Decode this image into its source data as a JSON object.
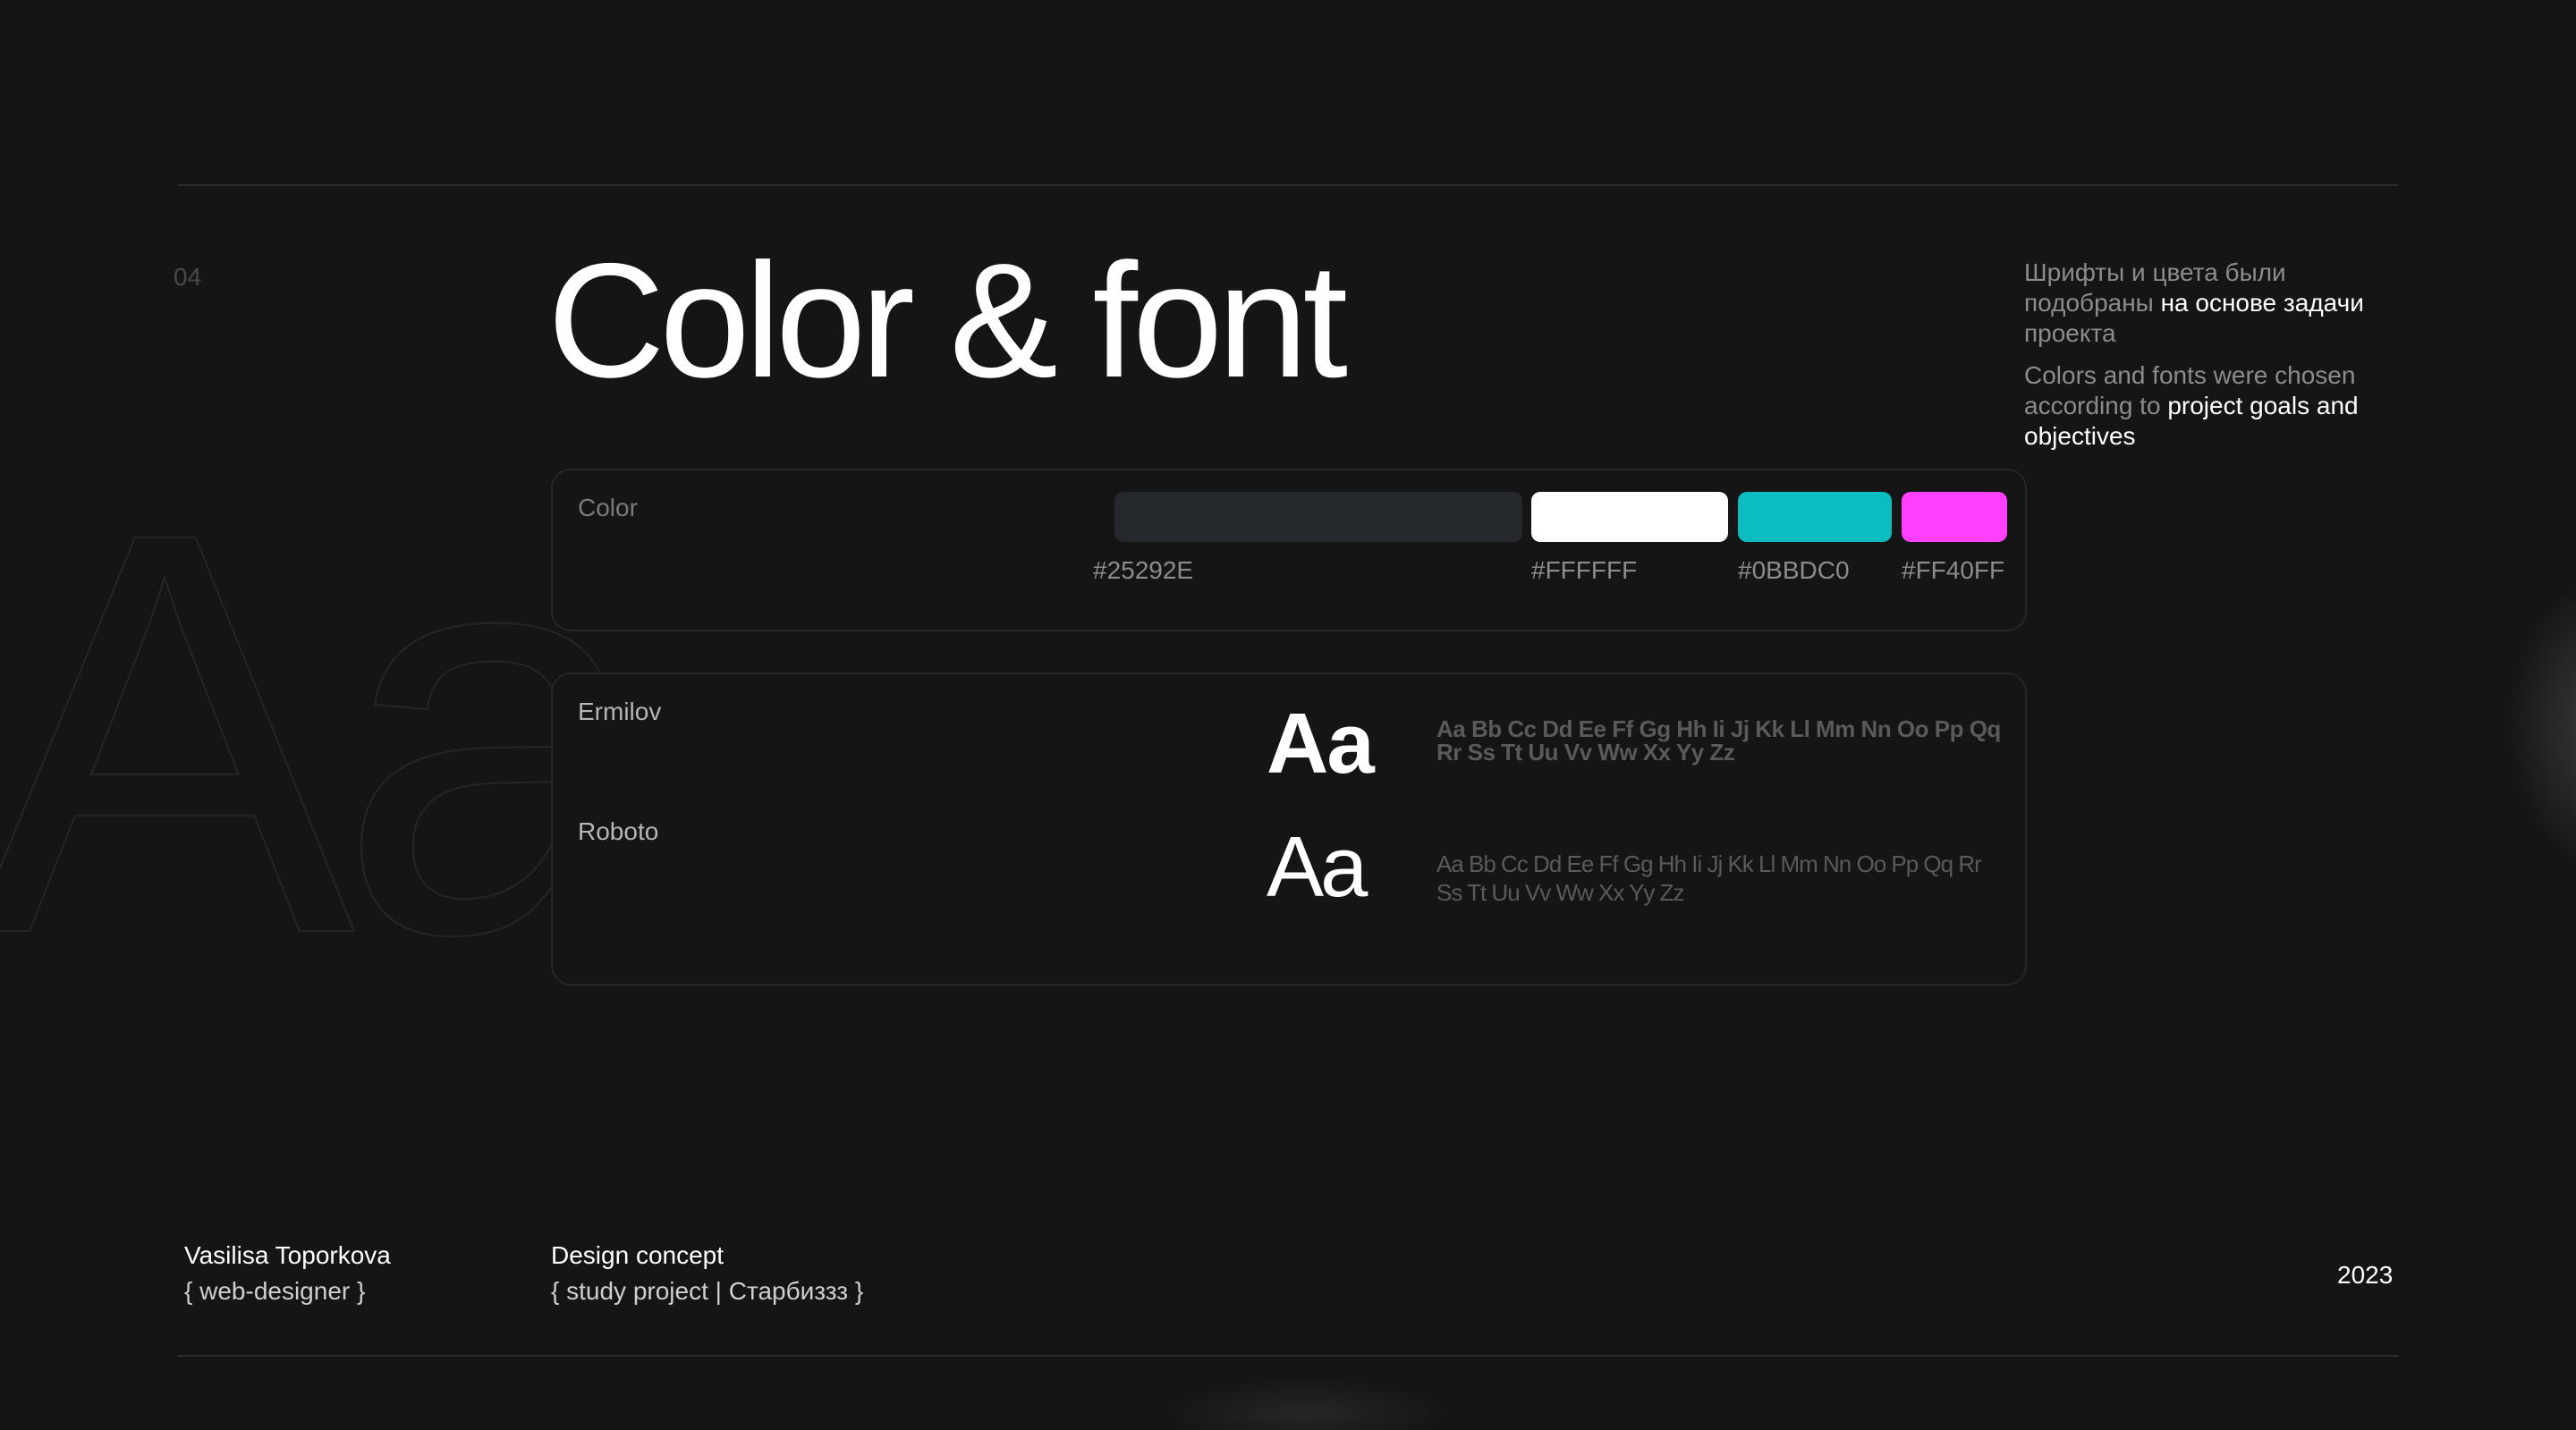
{
  "slide": {
    "number": "04",
    "title": "Color & font",
    "background_glyph": "Aa"
  },
  "description": {
    "ru_plain": "Шрифты и цвета были подобраны ",
    "ru_highlight": "на основе задачи",
    "ru_tail": " проекта",
    "en_plain": "Colors and fonts were chosen according to ",
    "en_highlight": "project goals and objectives"
  },
  "color_card": {
    "label": "Color",
    "swatches": [
      {
        "hex": "#25292E",
        "label": "#25292E"
      },
      {
        "hex": "#FFFFFF",
        "label": "#FFFFFF"
      },
      {
        "hex": "#0BBDC0",
        "label": "#0BBDC0"
      },
      {
        "hex": "#FF40FF",
        "label": "#FF40FF"
      }
    ]
  },
  "font_card": {
    "fonts": [
      {
        "name": "Ermilov",
        "sample": "Aa",
        "alphabet": "Aa Bb Cc Dd Ee Ff Gg Hh Ii Jj Kk Ll Mm Nn Oo Pp Qq Rr Ss Tt Uu Vv Ww Xx Yy Zz"
      },
      {
        "name": "Roboto",
        "sample": "Aa",
        "alphabet": "Aa Bb Cc Dd Ee Ff Gg Hh Ii Jj Kk Ll Mm Nn Oo Pp Qq Rr Ss Tt Uu Vv Ww Xx Yy Zz"
      }
    ]
  },
  "footer": {
    "author": "Vasilisa Toporkova",
    "role": "{ web-designer }",
    "project_title": "Design concept",
    "project_sub": "{ study project | Старбиззз }",
    "year": "2023"
  }
}
